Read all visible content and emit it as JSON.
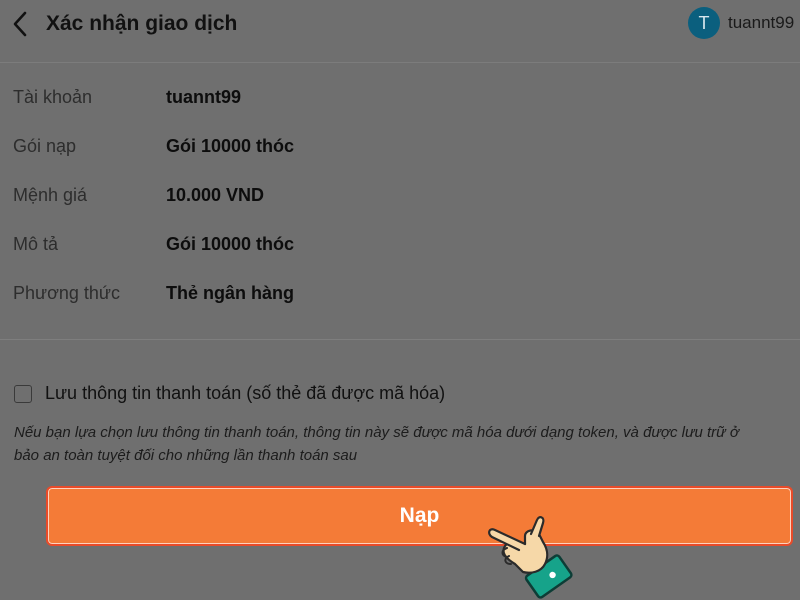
{
  "header": {
    "title": "Xác nhận giao dịch",
    "avatar_initial": "T",
    "username": "tuannt99"
  },
  "details": [
    {
      "label": "Tài khoản",
      "value": "tuannt99"
    },
    {
      "label": "Gói nạp",
      "value": "Gói 10000 thóc"
    },
    {
      "label": "Mệnh giá",
      "value": "10.000 VND"
    },
    {
      "label": "Mô tả",
      "value": "Gói 10000 thóc"
    },
    {
      "label": "Phương thức",
      "value": "Thẻ ngân hàng"
    }
  ],
  "save_payment": {
    "checked": false,
    "label": "Lưu thông tin thanh toán (số thẻ đã được mã hóa)",
    "note_line1": "Nếu bạn lựa chọn lưu thông tin thanh toán, thông tin này sẽ được mã hóa dưới dạng token, và được lưu trữ ở",
    "note_line2": "bảo an toàn tuyệt đối cho những lần thanh toán sau"
  },
  "submit_button": {
    "label": "Nạp"
  },
  "colors": {
    "overlay_background": "#6f6f6f",
    "button": "#f47b37",
    "button_border": "#e84b2a",
    "avatar": "#0b5f7e"
  },
  "icons": {
    "back": "chevron-left-icon",
    "pointer": "pointing-hand-icon"
  }
}
